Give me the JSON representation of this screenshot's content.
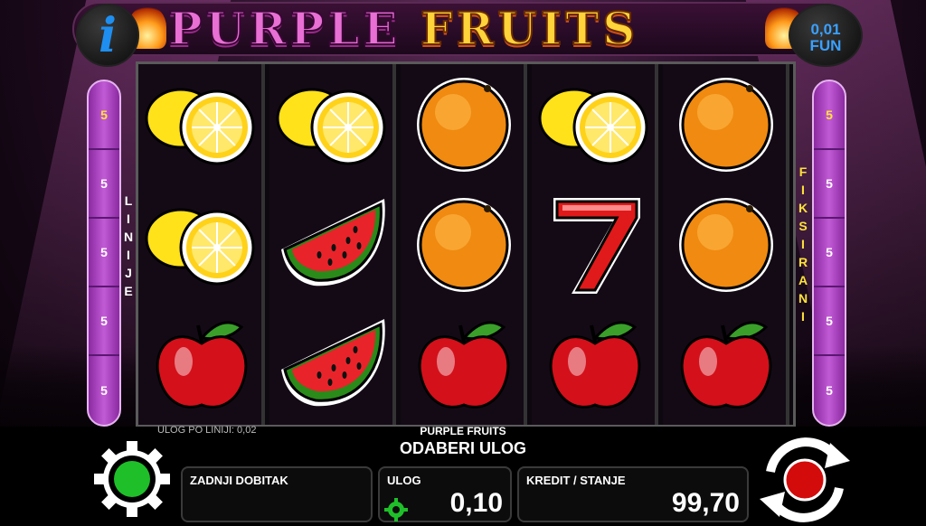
{
  "header": {
    "title_part1": "PURPLE",
    "title_part2": "FRUITS",
    "info_label": "i",
    "fun_value": "0,01",
    "fun_label": "FUN"
  },
  "left_rail": {
    "label": "LINIJE",
    "values": [
      "5",
      "5",
      "5",
      "5",
      "5"
    ]
  },
  "right_rail": {
    "label": "FIKSIRANI",
    "values": [
      "5",
      "5",
      "5",
      "5",
      "5"
    ]
  },
  "reels": [
    [
      "lemon-icon",
      "lemon-icon",
      "apple-icon"
    ],
    [
      "lemon-icon",
      "watermelon-icon",
      "watermelon-icon"
    ],
    [
      "orange-icon",
      "orange-icon",
      "apple-icon"
    ],
    [
      "lemon-icon",
      "seven-icon",
      "apple-icon"
    ],
    [
      "orange-icon",
      "orange-icon",
      "apple-icon"
    ]
  ],
  "footer": {
    "bet_per_line": "ULOG PO LINIJI: 0,02",
    "game_name": "PURPLE FRUITS",
    "prompt": "ODABERI ULOG",
    "last_win_label": "ZADNJI DOBITAK",
    "last_win_value": "",
    "bet_label": "ULOG",
    "bet_value": "0,10",
    "credit_label": "KREDIT / STANJE",
    "credit_value": "99,70"
  },
  "colors": {
    "accent_purple": "#c25ad6",
    "active_yellow": "#ffe23a",
    "info_blue": "#1e8ff0"
  }
}
